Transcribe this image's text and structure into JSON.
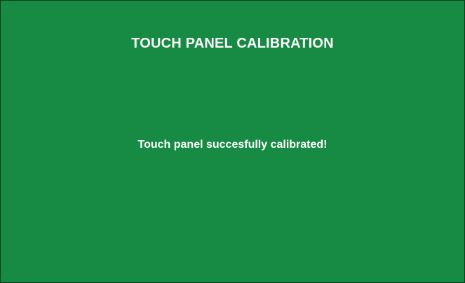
{
  "screen": {
    "title": "TOUCH PANEL CALIBRATION",
    "message": "Touch panel succesfully calibrated!",
    "background_color": "#178a43",
    "text_color": "#ffffff"
  }
}
